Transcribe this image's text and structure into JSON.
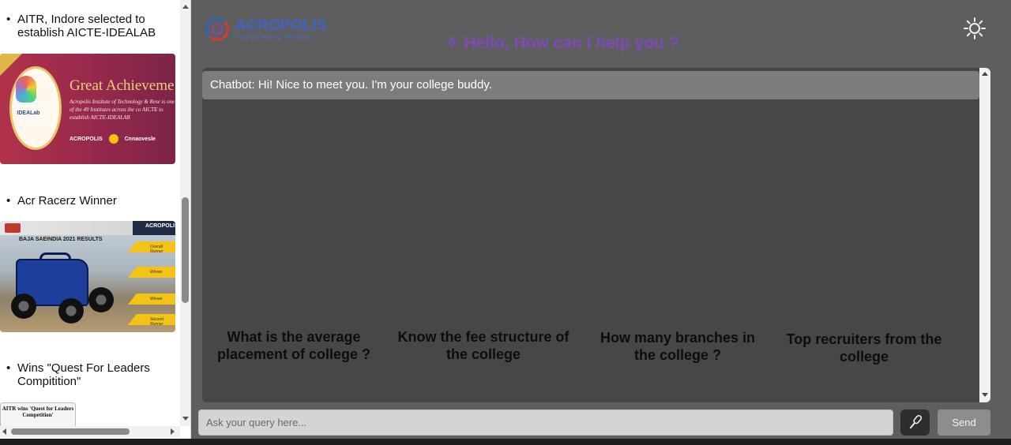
{
  "news": {
    "items": [
      {
        "title": "AITR, Indore selected to establish AICTE-IDEALAB",
        "image": {
          "headline": "Great Achieveme",
          "body": "Acropolis Institute of Technology & Rese is one of the 49 Institutes across the co AICTE to establish AICTE-IDEALAB",
          "badge": "IDEALab",
          "logo_a": "ACROPOLIS",
          "logo_b": "Cnnaovesle"
        }
      },
      {
        "title": "Acr Racerz Winner",
        "image": {
          "heading": "BAJA SAEINDIA 2021 RESULTS",
          "brand": "ACROPOLIS",
          "tags": [
            "Overall Runner",
            "Winner",
            "Winner",
            "Second Runner"
          ]
        }
      },
      {
        "title": "Wins \"Quest For Leaders Compitition\"",
        "image": {
          "caption": "AITR wins 'Quest for Leaders Competition'"
        }
      }
    ]
  },
  "header": {
    "brand": "ACROPOLIS",
    "tagline": "Enlightening Wisdom",
    "greeting": "✧ Hello, How can I help you ?"
  },
  "chat": {
    "bot_message": "Chatbot: Hi! Nice to meet you. I'm your college buddy.",
    "suggestions": [
      "What is the average placement of college ?",
      "Know the fee structure of the college",
      "How many branches in the college ?",
      "Top recruiters from the college"
    ]
  },
  "input": {
    "placeholder": "Ask your query here...",
    "value": ""
  },
  "buttons": {
    "send": "Send"
  },
  "icons": {
    "theme": "sun-icon",
    "mic": "microphone-icon"
  },
  "colors": {
    "accent": "#7d4bb8",
    "chat_bg": "#474747",
    "page_bg": "#5e5e5e",
    "bot_bubble": "#7c7c7c"
  }
}
